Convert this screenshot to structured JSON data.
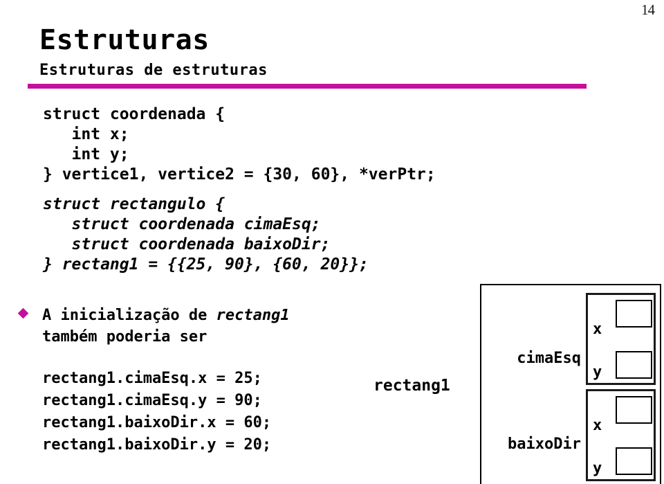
{
  "slide": {
    "number": "14",
    "title": "Estruturas",
    "subtitle": "Estruturas de estruturas",
    "accent_color": "#C4119B",
    "text_color": "#000000",
    "background_color": "#FFFFFF"
  },
  "code": {
    "coordenada": "struct coordenada {\n   int x;\n   int y;\n} vertice1, vertice2 = {30, 60}, *verPtr;",
    "rectangulo": "struct rectangulo {\n   struct coordenada cimaEsq;\n   struct coordenada baixoDir;\n} rectang1 = {{25, 90}, {60, 20}};"
  },
  "bullet": {
    "marker": "diamond-bullet",
    "text_before": "A inicialização de ",
    "text_italic": "rectang1",
    "text_after": "\ntambém poderia ser"
  },
  "assignments": {
    "lines": "rectang1.cimaEsq.x = 25;\nrectang1.cimaEsq.y = 90;\nrectang1.baixoDir.x = 60;\nrectang1.baixoDir.y = 20;"
  },
  "diagram": {
    "struct_label": "rectang1",
    "members": [
      {
        "name": "cimaEsq",
        "fields": [
          {
            "label": "x",
            "value": ""
          },
          {
            "label": "y",
            "value": ""
          }
        ]
      },
      {
        "name": "baixoDir",
        "fields": [
          {
            "label": "x",
            "value": ""
          },
          {
            "label": "y",
            "value": ""
          }
        ]
      }
    ]
  }
}
